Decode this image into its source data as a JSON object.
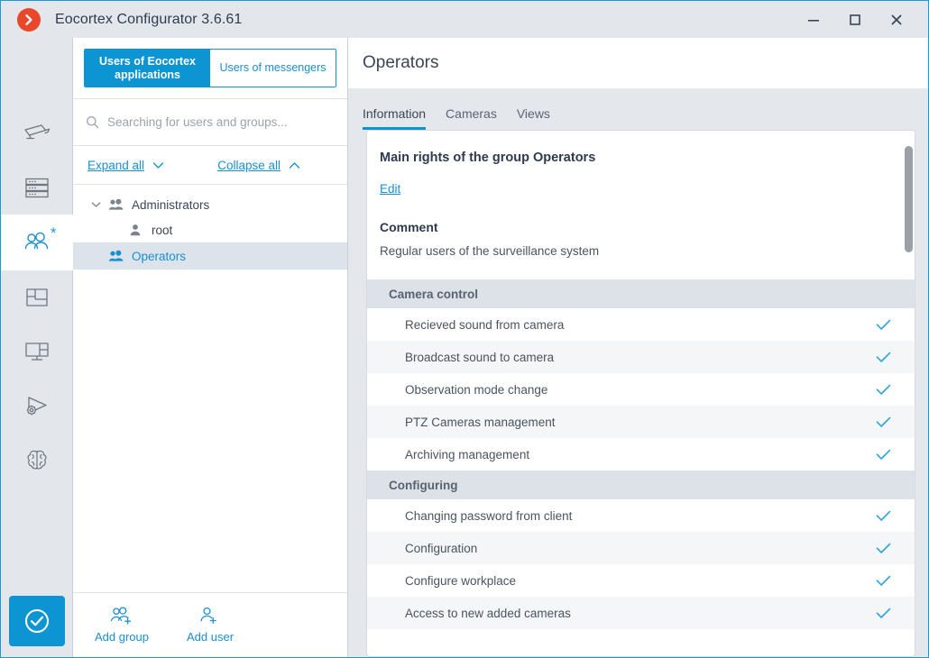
{
  "window": {
    "title": "Eocortex Configurator 3.6.61",
    "logo_icon": "chevron-right-circle-logo",
    "controls": [
      {
        "name": "minimize",
        "icon": "minimize-icon"
      },
      {
        "name": "maximize",
        "icon": "maximize-icon"
      },
      {
        "name": "close",
        "icon": "close-icon"
      }
    ],
    "accent_color": "#0d94d2",
    "logo_color": "#e8492a",
    "titlebar_color": "#e3e7eb"
  },
  "rail": {
    "items": [
      {
        "name": "cameras",
        "icon": "cctv-camera-icon",
        "active": false,
        "badge": ""
      },
      {
        "name": "servers",
        "icon": "servers-icon",
        "active": false,
        "badge": ""
      },
      {
        "name": "users",
        "icon": "users-group-icon",
        "active": true,
        "badge": "*"
      },
      {
        "name": "plans",
        "icon": "floor-plan-icon",
        "active": false,
        "badge": ""
      },
      {
        "name": "video-wall",
        "icon": "video-wall-icon",
        "active": false,
        "badge": ""
      },
      {
        "name": "automation",
        "icon": "automation-play-gear-icon",
        "active": false,
        "badge": ""
      },
      {
        "name": "analytics",
        "icon": "brain-icon",
        "active": false,
        "badge": ""
      }
    ],
    "apply": {
      "label": "",
      "icon": "check-circle-icon",
      "color": "#0d94d2"
    }
  },
  "users_panel": {
    "segmented": {
      "left": "Users of Eocortex applications",
      "right": "Users of messengers",
      "active": "left"
    },
    "search": {
      "placeholder": "Searching for users and groups...",
      "value": "",
      "icon": "search-icon"
    },
    "expand_all": "Expand all",
    "collapse_all": "Collapse all",
    "tree": [
      {
        "label": "Administrators",
        "icon": "group-icon",
        "level": 0,
        "expanded": true,
        "selected": false,
        "has_chevron": true
      },
      {
        "label": "root",
        "icon": "user-icon",
        "level": 1,
        "expanded": false,
        "selected": false,
        "has_chevron": false
      },
      {
        "label": "Operators",
        "icon": "group-icon",
        "level": 0,
        "expanded": false,
        "selected": true,
        "has_chevron": false
      }
    ],
    "footer": [
      {
        "label": "Add group",
        "icon": "add-group-icon"
      },
      {
        "label": "Add user",
        "icon": "add-user-icon"
      }
    ]
  },
  "main": {
    "page_title": "Operators",
    "tabs": [
      {
        "label": "Information",
        "active": true
      },
      {
        "label": "Cameras",
        "active": false
      },
      {
        "label": "Views",
        "active": false
      }
    ],
    "rights_title": "Main rights of the group  Operators",
    "edit_link": "Edit",
    "comment_title": "Comment",
    "comment_text": "Regular users of the surveillance system",
    "permission_sections": [
      {
        "title": "Camera control",
        "items": [
          {
            "label": "Recieved sound from camera",
            "enabled": true
          },
          {
            "label": "Broadcast sound to camera",
            "enabled": true
          },
          {
            "label": "Observation mode change",
            "enabled": true
          },
          {
            "label": "PTZ Cameras management",
            "enabled": true
          },
          {
            "label": "Archiving management",
            "enabled": true
          }
        ]
      },
      {
        "title": "Configuring",
        "items": [
          {
            "label": "Changing password from client",
            "enabled": true
          },
          {
            "label": "Configuration",
            "enabled": true
          },
          {
            "label": "Configure workplace",
            "enabled": true
          },
          {
            "label": "Access to new added cameras",
            "enabled": true
          }
        ]
      }
    ],
    "check_color": "#29a3dc"
  }
}
